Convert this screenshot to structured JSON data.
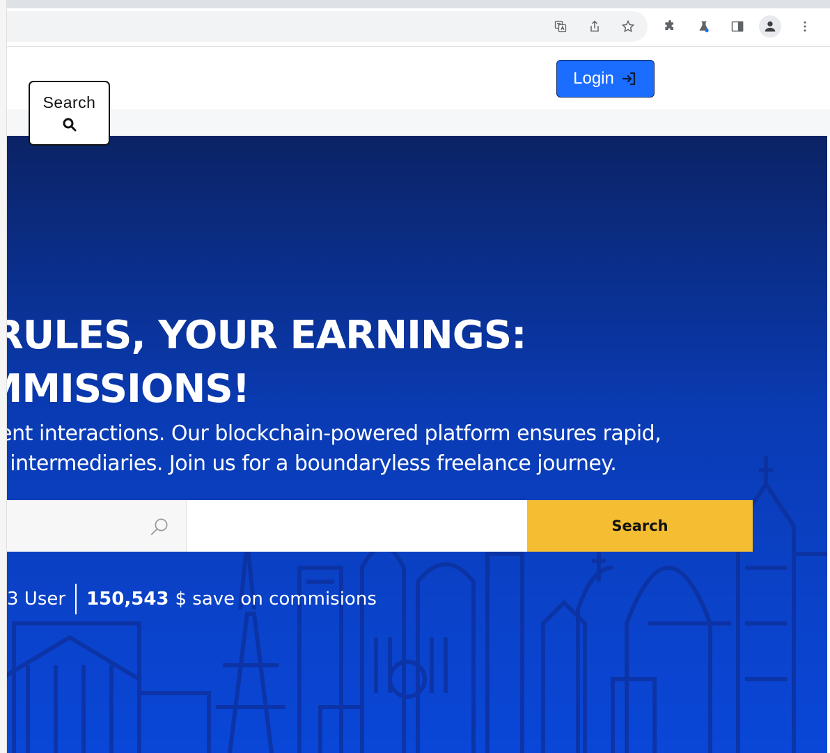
{
  "header": {
    "search_label": "Search",
    "login_label": "Login"
  },
  "hero": {
    "headline_line1": "R RULES, YOUR EARNINGS:",
    "headline_line2": "OMMISSIONS!",
    "subtitle_line1": "rent interactions. Our blockchain-powered platform ensures rapid,",
    "subtitle_line2": "y intermediaries. Join us for a boundaryless freelance journey.",
    "search_button_label": "Search",
    "stats": {
      "users_text": "3 User",
      "savings_value": "150,543",
      "savings_text": "$ save on commisions"
    }
  },
  "browser_toolbar": {
    "icons": [
      "translate-icon",
      "share-icon",
      "bookmark-star-icon",
      "extensions-icon",
      "labs-flask-icon",
      "side-panel-icon",
      "profile-icon",
      "menu-kebab-icon"
    ]
  },
  "colors": {
    "accent_blue": "#1a6dff",
    "search_yellow": "#f5be32",
    "hero_top": "#0b2365",
    "hero_bottom": "#0a47d8"
  }
}
